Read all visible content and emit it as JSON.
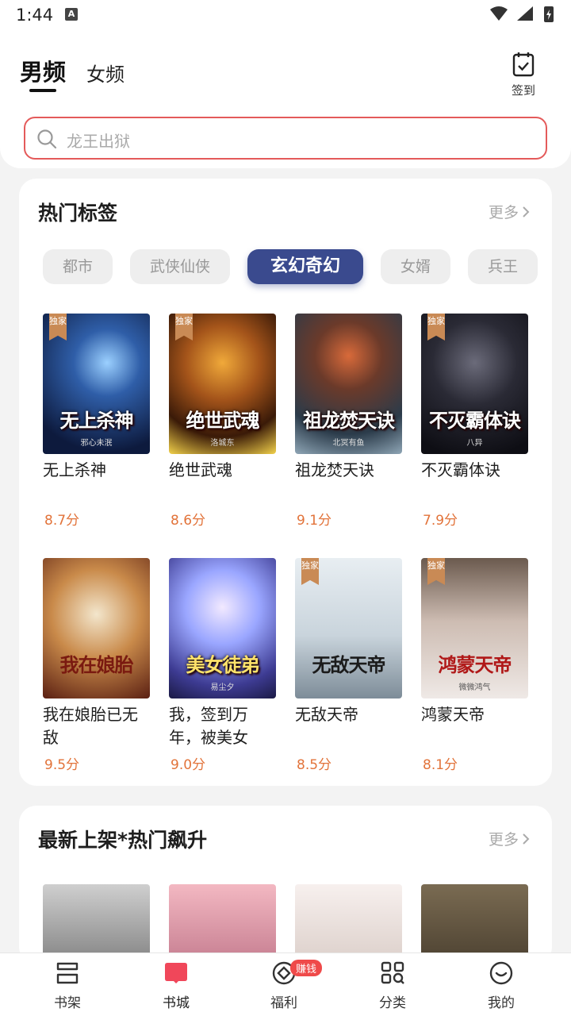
{
  "status_bar": {
    "time": "1:44",
    "notif_letter": "A"
  },
  "header": {
    "tab_active": "男频",
    "tab_other": "女频",
    "checkin_label": "签到"
  },
  "search": {
    "placeholder": "龙王出狱"
  },
  "hot_tags": {
    "title": "热门标签",
    "more": "更多",
    "chips": [
      "都市",
      "武侠仙侠",
      "玄幻奇幻",
      "女婿",
      "兵王"
    ],
    "active_chip": "玄幻奇幻",
    "books": [
      {
        "name": "无上杀神",
        "score": "8.7分",
        "badge": "独家",
        "cover_title": "无上杀神",
        "cover_author": "邪心未泯"
      },
      {
        "name": "绝世武魂",
        "score": "8.6分",
        "badge": "独家",
        "cover_title": "绝世武魂",
        "cover_author": "洛城东"
      },
      {
        "name": "祖龙焚天诀",
        "score": "9.1分",
        "badge": "",
        "cover_title": "祖龙焚天诀",
        "cover_author": "北冥有鱼"
      },
      {
        "name": "不灭霸体诀",
        "score": "7.9分",
        "badge": "独家",
        "cover_title": "不灭霸体诀",
        "cover_author": "八异"
      },
      {
        "name": "我在娘胎已无敌",
        "score": "9.5分",
        "badge": "",
        "cover_title": "我在娘胎",
        "cover_author": ""
      },
      {
        "name": "我，签到万年，被美女徒...",
        "score": "9.0分",
        "badge": "",
        "cover_title": "美女徒弟",
        "cover_author": "易尘夕"
      },
      {
        "name": "无敌天帝",
        "score": "8.5分",
        "badge": "独家",
        "cover_title": "无敌天帝",
        "cover_author": ""
      },
      {
        "name": "鸿蒙天帝",
        "score": "8.1分",
        "badge": "独家",
        "cover_title": "鸿蒙天帝",
        "cover_author": "微微鸿气"
      }
    ]
  },
  "new_hot": {
    "title": "最新上架*热门飙升",
    "more": "更多"
  },
  "tabbar": {
    "items": [
      "书架",
      "书城",
      "福利",
      "分类",
      "我的"
    ],
    "earn_badge": "赚钱",
    "active": "书城"
  }
}
